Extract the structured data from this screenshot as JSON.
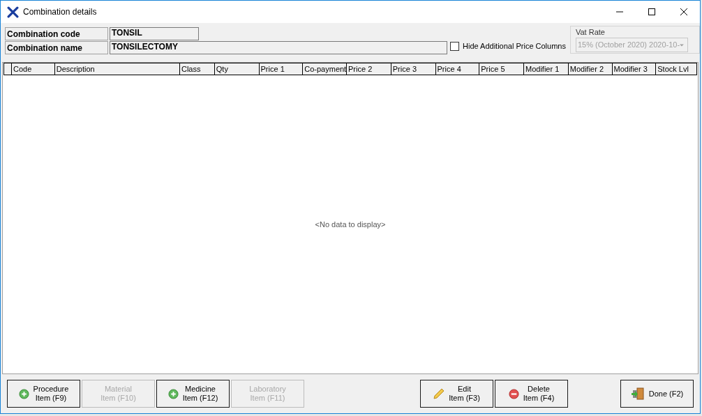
{
  "window": {
    "title": "Combination details"
  },
  "fields": [
    {
      "label": "Combination code",
      "value": "TONSIL",
      "kind": "short"
    },
    {
      "label": "Combination name",
      "value": "TONSILECTOMY",
      "kind": "long"
    }
  ],
  "hide_additional_price_columns": {
    "label": "Hide Additional Price Columns",
    "checked": false
  },
  "vat_rate": {
    "label": "Vat Rate",
    "value": "15% (October 2020) 2020-10-",
    "disabled": true
  },
  "table": {
    "columns": [
      "Code",
      "Description",
      "Class",
      "Qty",
      "Price 1",
      "Co-payment",
      "Price 2",
      "Price 3",
      "Price 4",
      "Price 5",
      "Modifier 1",
      "Modifier 2",
      "Modifier 3",
      "Stock Lvl"
    ],
    "empty_text": "<No data to display>"
  },
  "buttons": [
    {
      "label": "Procedure",
      "shortcut": "Item (F9)",
      "kind": "add",
      "disabled": false
    },
    {
      "label": "Material",
      "shortcut": "Item (F10)",
      "kind": "add",
      "disabled": true
    },
    {
      "label": "Medicine",
      "shortcut": "Item (F12)",
      "kind": "add",
      "disabled": false
    },
    {
      "label": "Laboratory",
      "shortcut": "Item (F11)",
      "kind": "add",
      "disabled": true
    },
    {
      "label": "Edit",
      "shortcut": "Item (F3)",
      "kind": "edit",
      "disabled": false
    },
    {
      "label": "Delete",
      "shortcut": "Item (F4)",
      "kind": "delete",
      "disabled": false
    },
    {
      "label": "Done (F2)",
      "kind": "exit",
      "disabled": false
    }
  ]
}
